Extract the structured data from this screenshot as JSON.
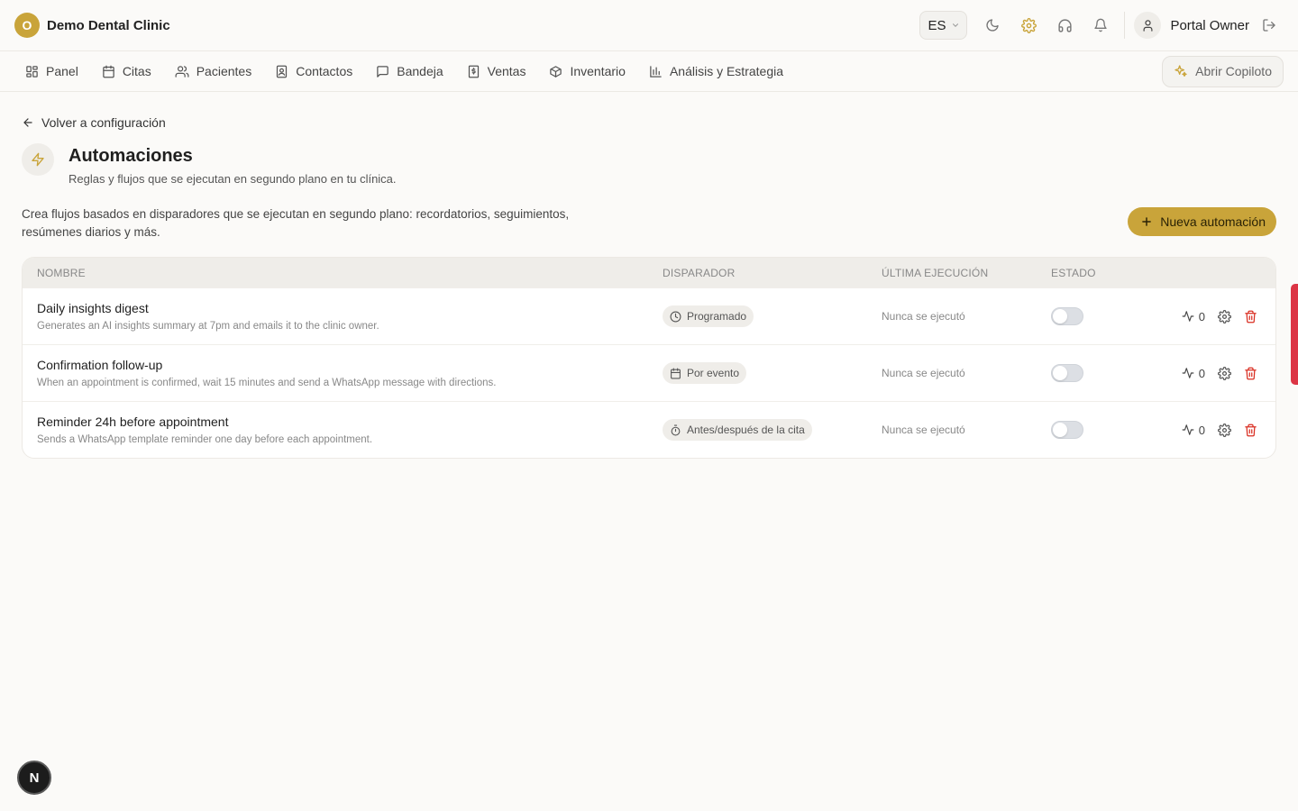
{
  "app": {
    "logo_letter": "O",
    "clinic_name": "Demo Dental Clinic",
    "accent_color": "#c9a43a"
  },
  "topbar": {
    "language": "ES",
    "user_name": "Portal Owner",
    "icons": [
      "moon-icon",
      "gear-icon",
      "headset-icon",
      "bell-icon",
      "user-icon",
      "logout-icon"
    ]
  },
  "nav": {
    "items": [
      {
        "label": "Panel",
        "icon": "dashboard-icon"
      },
      {
        "label": "Citas",
        "icon": "calendar-icon"
      },
      {
        "label": "Pacientes",
        "icon": "users-icon"
      },
      {
        "label": "Contactos",
        "icon": "contact-icon"
      },
      {
        "label": "Bandeja",
        "icon": "message-icon"
      },
      {
        "label": "Ventas",
        "icon": "receipt-icon"
      },
      {
        "label": "Inventario",
        "icon": "box-icon"
      },
      {
        "label": "Análisis y Estrategia",
        "icon": "chart-icon"
      }
    ],
    "copilot_label": "Abrir Copiloto"
  },
  "page": {
    "back_label": "Volver a configuración",
    "title": "Automaciones",
    "subtitle": "Reglas y flujos que se ejecutan en segundo plano en tu clínica.",
    "description_line1": "Crea flujos basados en disparadores que se ejecutan en segundo plano: recordatorios, seguimientos,",
    "description_line2": "resúmenes diarios y más.",
    "new_button": "Nueva automación"
  },
  "table": {
    "headers": {
      "name": "NOMBRE",
      "trigger": "DISPARADOR",
      "last_run": "ÚLTIMA EJECUCIÓN",
      "status": "ESTADO"
    },
    "rows": [
      {
        "name": "Daily insights digest",
        "description": "Generates an AI insights summary at 7pm and emails it to the clinic owner.",
        "trigger": "Programado",
        "trigger_icon": "clock-icon",
        "last_run": "Nunca se ejecutó",
        "enabled": false,
        "runs": "0"
      },
      {
        "name": "Confirmation follow-up",
        "description": "When an appointment is confirmed, wait 15 minutes and send a WhatsApp message with directions.",
        "trigger": "Por evento",
        "trigger_icon": "calendar-icon",
        "last_run": "Nunca se ejecutó",
        "enabled": false,
        "runs": "0"
      },
      {
        "name": "Reminder 24h before appointment",
        "description": "Sends a WhatsApp template reminder one day before each appointment.",
        "trigger": "Antes/después de la cita",
        "trigger_icon": "timer-icon",
        "last_run": "Nunca se ejecutó",
        "enabled": false,
        "runs": "0"
      }
    ]
  },
  "dev_badge": "N"
}
